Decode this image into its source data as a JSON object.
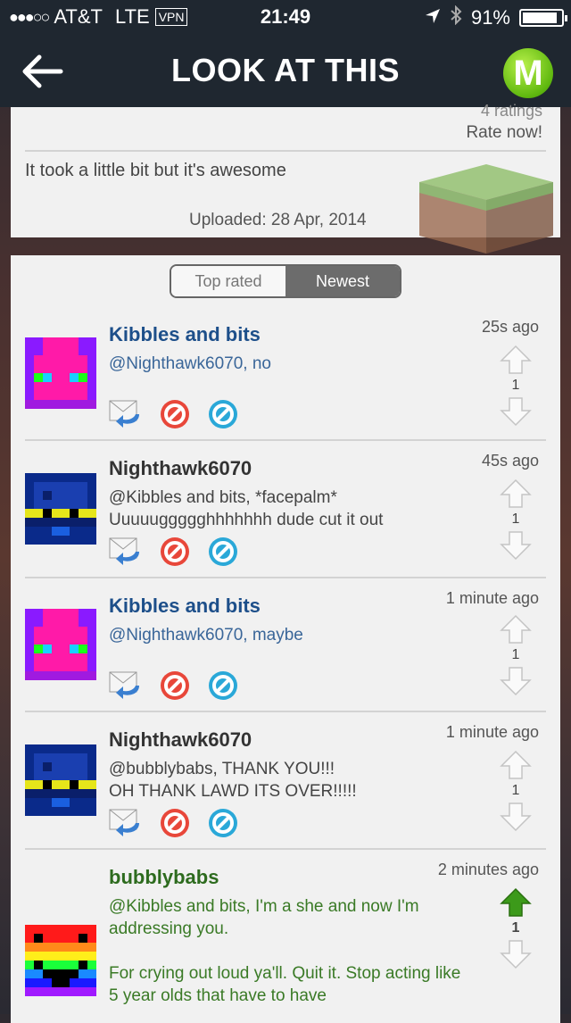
{
  "status": {
    "carrier": "AT&T",
    "network": "LTE",
    "vpn": "VPN",
    "time": "21:49",
    "battery": "91%",
    "battery_level": 0.91
  },
  "header": {
    "title": "LOOK AT THIS",
    "logo_letter": "M"
  },
  "upload": {
    "ratings": "4 ratings",
    "rate_now": "Rate now!",
    "description": "It took a little bit but it's awesome",
    "uploaded": "Uploaded: 28 Apr, 2014"
  },
  "tabs": {
    "top_rated": "Top rated",
    "newest": "Newest",
    "active": "Newest"
  },
  "comments": [
    {
      "name": "Kibbles and bits",
      "text": "@Nighthawk6070, no",
      "time": "25s ago",
      "votes": "1",
      "upvoted": false
    },
    {
      "name": "Nighthawk6070",
      "text": "@Kibbles and bits, *facepalm*\nUuuuuggggghhhhhhh dude cut it out",
      "time": "45s ago",
      "votes": "1",
      "upvoted": false
    },
    {
      "name": "Kibbles and bits",
      "text": "@Nighthawk6070, maybe",
      "time": "1 minute ago",
      "votes": "1",
      "upvoted": false
    },
    {
      "name": "Nighthawk6070",
      "text": "@bubblybabs, THANK YOU!!!\nOH THANK LAWD ITS OVER!!!!!",
      "time": "1 minute ago",
      "votes": "1",
      "upvoted": false
    },
    {
      "name": "bubblybabs",
      "text": "@Kibbles and bits, I'm a she and now I'm addressing you.\n\nFor crying out loud ya'll. Quit it. Stop acting like 5 year olds that have to have",
      "time": "2 minutes ago",
      "votes": "1",
      "upvoted": true
    }
  ],
  "colors": {
    "topbar": "#1f2730",
    "upvote_active": "#3c9a1a",
    "link_blue": "#1d4f8a"
  }
}
